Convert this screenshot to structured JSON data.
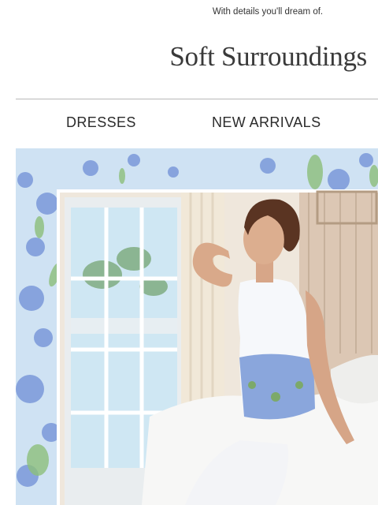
{
  "header": {
    "tagline": "With details you'll dream of.",
    "brand": "Soft Surroundings"
  },
  "nav": {
    "items": [
      {
        "label": "DRESSES"
      },
      {
        "label": "NEW ARRIVALS"
      }
    ]
  },
  "hero": {
    "image_icon": "hero-photo-icon",
    "colors": {
      "border_blue": "#c9dff2",
      "floral_blue": "#6f8fd6",
      "leaf_green": "#8cbf7a",
      "wall_cream": "#f4ede2"
    }
  }
}
